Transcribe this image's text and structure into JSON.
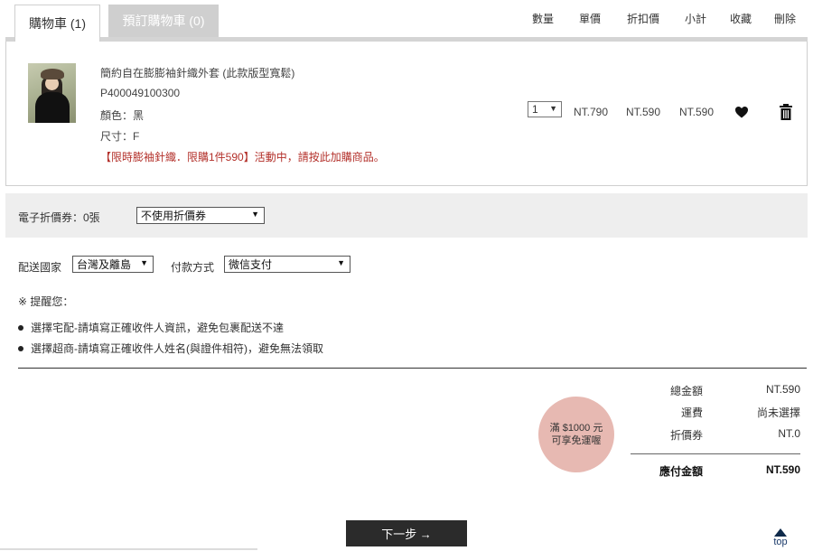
{
  "tabs": [
    {
      "label": "購物車 (1)",
      "active": true
    },
    {
      "label": "預訂購物車 (0)",
      "active": false
    }
  ],
  "columns": {
    "qty": "數量",
    "unit_price": "單價",
    "discount_price": "折扣價",
    "subtotal": "小計",
    "favorite": "收藏",
    "delete": "刪除"
  },
  "item": {
    "name": "簡約自在膨膨袖針織外套 (此款版型寬鬆)",
    "sku": "P400049100300",
    "color": "顏色：黑",
    "size": "尺寸：F",
    "promo": "【限時膨袖針織．限購1件590】活動中，請按此加購商品。",
    "qty": "1",
    "unit_price": "NT.790",
    "discount_price": "NT.590",
    "subtotal": "NT.590",
    "image_icon": "product-photo",
    "favorite_icon": "heart-icon",
    "delete_icon": "trash-icon"
  },
  "coupon": {
    "label": "電子折價券：0張",
    "selected": "不使用折價券"
  },
  "shipping": {
    "country_label": "配送國家",
    "country_selected": "台灣及離島",
    "payment_label": "付款方式",
    "payment_selected": "微信支付"
  },
  "notes": {
    "title": "※ 提醒您：",
    "items": [
      "選擇宅配-請填寫正確收件人資訊，避免包裹配送不達",
      "選擇超商-請填寫正確收件人姓名(與證件相符)，避免無法領取"
    ]
  },
  "free_shipping": {
    "line1": "滿 $1000 元",
    "line2": "可享免運喔",
    "color": "#e7b9b2"
  },
  "summary": {
    "total_label": "總金額",
    "total_value": "NT.590",
    "shipping_label": "運費",
    "shipping_value": "尚未選擇",
    "coupon_label": "折價券",
    "coupon_value": "NT.0",
    "payable_label": "應付金額",
    "payable_value": "NT.590"
  },
  "next_button": "下一步 →",
  "top_button": "top",
  "colors": {
    "promo_red": "#b3302a",
    "button_dark": "#2b2b2b",
    "tab_inactive": "#cfcfcf"
  }
}
